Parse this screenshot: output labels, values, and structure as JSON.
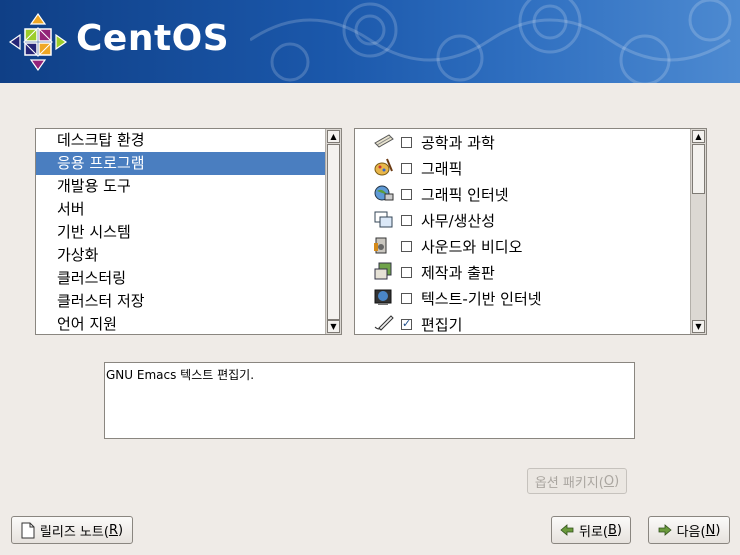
{
  "header": {
    "brand": "CentOS",
    "colors": {
      "banner": "#1b58ab",
      "brand_text": "#ffffff"
    },
    "logo_icon": "centos-logo-icon"
  },
  "categories": {
    "items": [
      {
        "label": "데스크탑 환경",
        "selected": false
      },
      {
        "label": "응용 프로그램",
        "selected": true
      },
      {
        "label": "개발용 도구",
        "selected": false
      },
      {
        "label": "서버",
        "selected": false
      },
      {
        "label": "기반 시스템",
        "selected": false
      },
      {
        "label": "가상화",
        "selected": false
      },
      {
        "label": "클러스터링",
        "selected": false
      },
      {
        "label": "클러스터 저장",
        "selected": false
      },
      {
        "label": "언어 지원",
        "selected": false
      }
    ],
    "selection_color": "#4a7ec0"
  },
  "groups": {
    "items": [
      {
        "label": "공학과 과학",
        "checked": false,
        "icon": "science-icon"
      },
      {
        "label": "그래픽",
        "checked": false,
        "icon": "graphics-icon"
      },
      {
        "label": "그래픽 인터넷",
        "checked": false,
        "icon": "graphical-internet-icon"
      },
      {
        "label": "사무/생산성",
        "checked": false,
        "icon": "office-icon"
      },
      {
        "label": "사운드와 비디오",
        "checked": false,
        "icon": "sound-video-icon"
      },
      {
        "label": "제작과 출판",
        "checked": false,
        "icon": "authoring-icon"
      },
      {
        "label": "텍스트-기반 인터넷",
        "checked": false,
        "icon": "text-internet-icon"
      },
      {
        "label": "편집기",
        "checked": true,
        "icon": "editor-icon"
      }
    ]
  },
  "description": {
    "text": "GNU Emacs 텍스트 편집기."
  },
  "buttons": {
    "optional_packages": {
      "label": "옵션 패키지(",
      "mnemonic": "O",
      "suffix": ")",
      "enabled": false
    },
    "release_notes": {
      "label": "릴리즈 노트(",
      "mnemonic": "R",
      "suffix": ")",
      "icon": "document-icon"
    },
    "back": {
      "label": "뒤로(",
      "mnemonic": "B",
      "suffix": ")",
      "icon": "arrow-left-icon"
    },
    "next": {
      "label": "다음(",
      "mnemonic": "N",
      "suffix": ")",
      "icon": "arrow-right-icon"
    }
  }
}
